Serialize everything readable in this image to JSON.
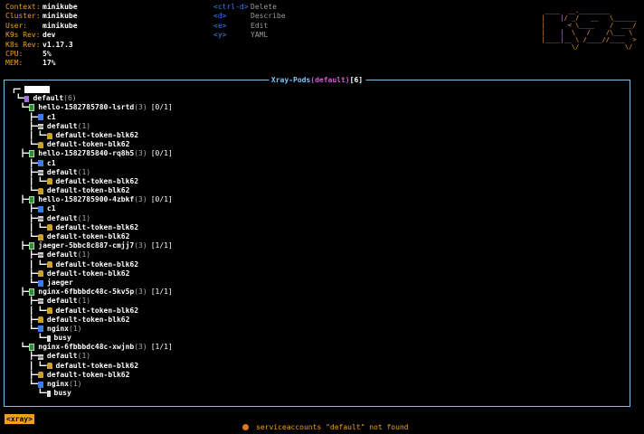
{
  "header": {
    "items": [
      {
        "label": "Context:",
        "value": "minikube"
      },
      {
        "label": "Cluster:",
        "value": "minikube"
      },
      {
        "label": "User:",
        "value": "minikube"
      },
      {
        "label": "K9s Rev:",
        "value": "dev"
      },
      {
        "label": "K8s Rev:",
        "value": "v1.17.3"
      },
      {
        "label": "CPU:",
        "value": "5%"
      },
      {
        "label": "MEM:",
        "value": "17%"
      }
    ]
  },
  "key_hints": [
    {
      "key": "<ctrl-d>",
      "action": "Delete"
    },
    {
      "key": "<d>",
      "action": "Describe"
    },
    {
      "key": "<e>",
      "action": "Edit"
    },
    {
      "key": "<y>",
      "action": "YAML"
    }
  ],
  "logo": {
    "text": "K9s"
  },
  "panel": {
    "title_word": "Xray-Pods",
    "title_ns": "(default)",
    "title_count": "[6]"
  },
  "tree": {
    "root": "default",
    "root_count": "(6)",
    "nodes": [
      {
        "pre": "  ┗━",
        "type": "pod",
        "name": "hello-1582785780-lsrtd",
        "count": "(3)",
        "status": "[0/1]"
      },
      {
        "pre": "    ┣━",
        "type": "ctn",
        "name": "c1",
        "count": "",
        "status": ""
      },
      {
        "pre": "    ┣━",
        "type": "sa",
        "name": "default",
        "count": "(1)",
        "status": ""
      },
      {
        "pre": "    ┃ ┗━",
        "type": "lock",
        "name": "default-token-blk62",
        "count": "",
        "status": ""
      },
      {
        "pre": "    ┗━",
        "type": "lock",
        "name": "default-token-blk62",
        "count": "",
        "status": ""
      },
      {
        "pre": "  ┣━",
        "type": "pod",
        "name": "hello-1582785840-rq8h5",
        "count": "(3)",
        "status": "[0/1]"
      },
      {
        "pre": "    ┣━",
        "type": "ctn",
        "name": "c1",
        "count": "",
        "status": ""
      },
      {
        "pre": "    ┣━",
        "type": "sa",
        "name": "default",
        "count": "(1)",
        "status": ""
      },
      {
        "pre": "    ┃ ┗━",
        "type": "lock",
        "name": "default-token-blk62",
        "count": "",
        "status": ""
      },
      {
        "pre": "    ┗━",
        "type": "lock",
        "name": "default-token-blk62",
        "count": "",
        "status": ""
      },
      {
        "pre": "  ┣━",
        "type": "pod",
        "name": "hello-1582785900-4zbkf",
        "count": "(3)",
        "status": "[0/1]"
      },
      {
        "pre": "    ┣━",
        "type": "ctn",
        "name": "c1",
        "count": "",
        "status": ""
      },
      {
        "pre": "    ┣━",
        "type": "sa",
        "name": "default",
        "count": "(1)",
        "status": ""
      },
      {
        "pre": "    ┃ ┗━",
        "type": "lock",
        "name": "default-token-blk62",
        "count": "",
        "status": ""
      },
      {
        "pre": "    ┗━",
        "type": "lock",
        "name": "default-token-blk62",
        "count": "",
        "status": ""
      },
      {
        "pre": "  ┣━",
        "type": "pod",
        "name": "jaeger-5bbc8c887-cmjj7",
        "count": "(3)",
        "status": "[1/1]"
      },
      {
        "pre": "    ┣━",
        "type": "sa",
        "name": "default",
        "count": "(1)",
        "status": ""
      },
      {
        "pre": "    ┃ ┗━",
        "type": "lock",
        "name": "default-token-blk62",
        "count": "",
        "status": ""
      },
      {
        "pre": "    ┣━",
        "type": "lock",
        "name": "default-token-blk62",
        "count": "",
        "status": ""
      },
      {
        "pre": "    ┗━",
        "type": "ctn",
        "name": "jaeger",
        "count": "",
        "status": ""
      },
      {
        "pre": "  ┣━",
        "type": "pod",
        "name": "nginx-6fbbbdc48c-5kv5p",
        "count": "(3)",
        "status": "[1/1]"
      },
      {
        "pre": "    ┣━",
        "type": "sa",
        "name": "default",
        "count": "(1)",
        "status": ""
      },
      {
        "pre": "    ┃ ┗━",
        "type": "lock",
        "name": "default-token-blk62",
        "count": "",
        "status": ""
      },
      {
        "pre": "    ┣━",
        "type": "lock",
        "name": "default-token-blk62",
        "count": "",
        "status": ""
      },
      {
        "pre": "    ┗━",
        "type": "ctn",
        "name": "nginx",
        "count": "(1)",
        "status": ""
      },
      {
        "pre": "      ┗━",
        "type": "bin",
        "name": "busy",
        "count": "",
        "status": ""
      },
      {
        "pre": "  ┗━",
        "type": "pod",
        "name": "nginx-6fbbbdc48c-xwjnb",
        "count": "(3)",
        "status": "[1/1]"
      },
      {
        "pre": "    ┣━",
        "type": "sa",
        "name": "default",
        "count": "(1)",
        "status": ""
      },
      {
        "pre": "    ┃ ┗━",
        "type": "lock",
        "name": "default-token-blk62",
        "count": "",
        "status": ""
      },
      {
        "pre": "    ┣━",
        "type": "lock",
        "name": "default-token-blk62",
        "count": "",
        "status": ""
      },
      {
        "pre": "    ┗━",
        "type": "ctn",
        "name": "nginx",
        "count": "(1)",
        "status": ""
      },
      {
        "pre": "      ┗━",
        "type": "bin",
        "name": "busy",
        "count": "",
        "status": ""
      }
    ]
  },
  "footer": {
    "crumb": "<xray>",
    "flash": "serviceaccounts \"default\" not found"
  }
}
